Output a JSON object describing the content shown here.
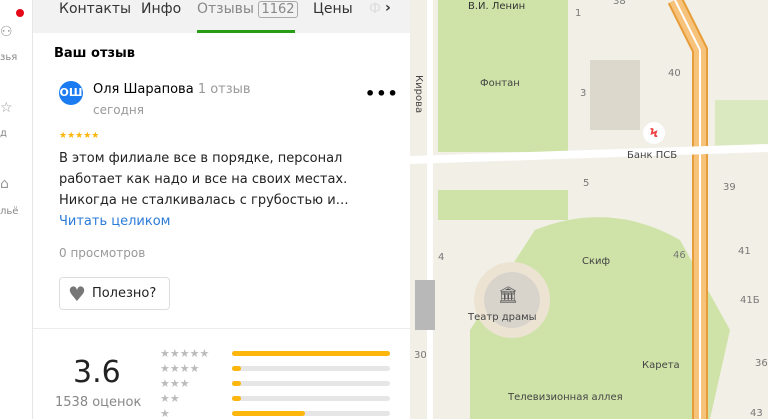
{
  "rail": {
    "items": [
      "зья",
      "д",
      "льё"
    ]
  },
  "tabs": [
    {
      "label": "Контакты"
    },
    {
      "label": "Инфо"
    },
    {
      "label": "Отзывы",
      "count": "1162"
    },
    {
      "label": "Цены"
    },
    {
      "label": "Ф"
    }
  ],
  "your_review": {
    "heading": "Ваш отзыв"
  },
  "review": {
    "avatar": "ОШ",
    "author": "Оля Шарапова",
    "count": "1 отзыв",
    "date": "сегодня",
    "stars": "★★★★★",
    "rating": 5,
    "text": "В этом филиале все в порядке, персонал работает как надо и все на своих местах. Никогда не сталкивалась с грубостью и…",
    "read_more": "Читать целиком",
    "views": "0 просмотров",
    "useful": "Полезно?",
    "more": "•••"
  },
  "summary": {
    "score": "3.6",
    "votes": "1538 оценок",
    "rows": [
      {
        "stars": "★★★★★",
        "fraction": 1.0
      },
      {
        "stars": "★★★★",
        "fraction": 0.04
      },
      {
        "stars": "★★★",
        "fraction": 0.035
      },
      {
        "stars": "★★",
        "fraction": 0.045
      },
      {
        "stars": "★",
        "fraction": 0.46
      }
    ]
  },
  "map": {
    "labels": {
      "lenin": "В.И. Ленин",
      "kirova": "Кирова",
      "fontan": "Фонтан",
      "bank": "Банк ПСБ",
      "skif": "Скиф",
      "theatre": "Театр драмы",
      "kareta": "Карета",
      "alley": "Телевизионная аллея"
    },
    "numbers": [
      "1",
      "38",
      "40",
      "3",
      "39",
      "5",
      "4",
      "46",
      "41",
      "41Б",
      "30",
      "36",
      "43"
    ]
  },
  "colors": {
    "accent": "#2a9d17",
    "star": "#fcb60c",
    "link": "#2a7bd8",
    "road": "#f7c27a",
    "park": "#cfe3a8"
  }
}
